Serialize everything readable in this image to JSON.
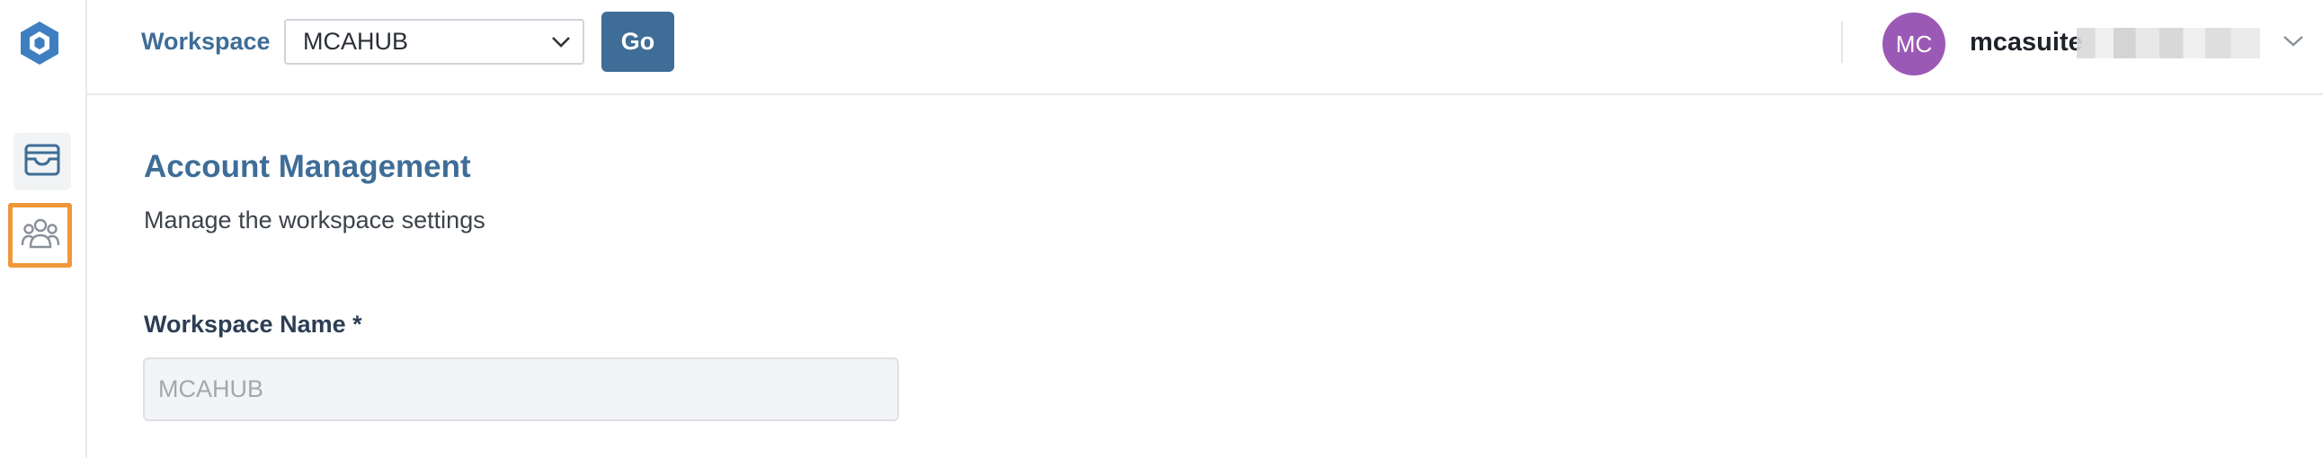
{
  "sidebar": {
    "logo_icon": "hexagon-logo-icon",
    "items": [
      {
        "name": "workspace",
        "icon": "inbox-tray-icon",
        "active": true
      },
      {
        "name": "users",
        "icon": "users-group-icon",
        "highlighted": true
      }
    ]
  },
  "header": {
    "workspace_label": "Workspace",
    "workspace_select": {
      "value": "MCAHUB",
      "options": [
        "MCAHUB"
      ]
    },
    "go_button": "Go",
    "user": {
      "initials": "MC",
      "avatar_color": "#9b59b6",
      "name": "mcasuite"
    }
  },
  "main": {
    "title": "Account Management",
    "subtitle": "Manage the workspace settings",
    "workspace_name": {
      "label": "Workspace Name *",
      "value": "MCAHUB"
    }
  },
  "colors": {
    "accent": "#3e6d97",
    "highlight_border": "#f0973a"
  }
}
